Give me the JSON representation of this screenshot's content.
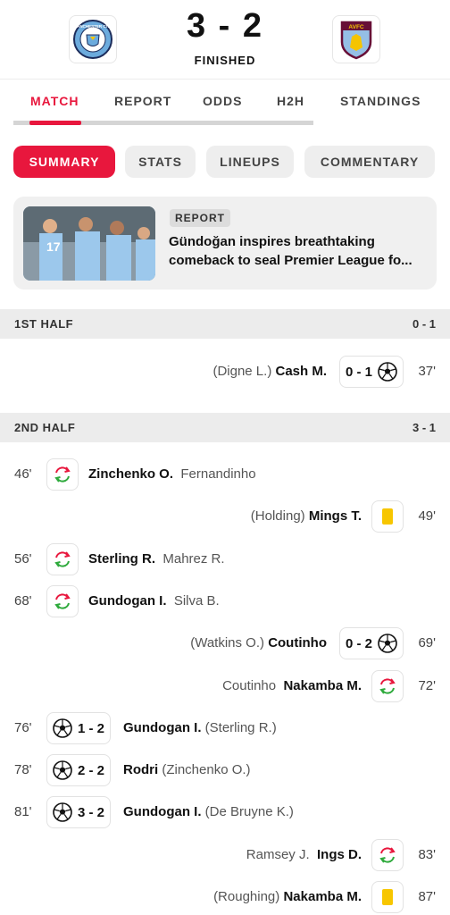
{
  "header": {
    "home_team_logo": "manchester-city-crest",
    "away_team_logo": "aston-villa-crest",
    "home_logo_text": "MANCHESTER CITY",
    "away_logo_text": "AVFC",
    "score": "3 - 2",
    "status": "FINISHED"
  },
  "main_tabs": [
    "MATCH",
    "REPORT",
    "ODDS",
    "H2H",
    "STANDINGS"
  ],
  "sub_tabs": [
    "SUMMARY",
    "STATS",
    "LINEUPS",
    "COMMENTARY"
  ],
  "report_card": {
    "badge": "REPORT",
    "title": "Gündoğan inspires breathtaking comeback to seal Premier League fo..."
  },
  "first_half": {
    "label": "1ST HALF",
    "score": "0 - 1",
    "events": [
      {
        "minute": "37'",
        "side": "away",
        "type": "goal",
        "score": "0 - 1",
        "player": "Cash M.",
        "detail": "(Digne L.)"
      }
    ]
  },
  "second_half": {
    "label": "2ND HALF",
    "score": "3 - 1",
    "events": [
      {
        "minute": "46'",
        "side": "home",
        "type": "substitution",
        "player": "Zinchenko O.",
        "detail": "Fernandinho"
      },
      {
        "minute": "49'",
        "side": "away",
        "type": "yellow-card",
        "player": "Mings T.",
        "detail": "(Holding)"
      },
      {
        "minute": "56'",
        "side": "home",
        "type": "substitution",
        "player": "Sterling R.",
        "detail": "Mahrez R."
      },
      {
        "minute": "68'",
        "side": "home",
        "type": "substitution",
        "player": "Gundogan I.",
        "detail": "Silva B."
      },
      {
        "minute": "69'",
        "side": "away",
        "type": "goal",
        "score": "0 - 2",
        "player": "Coutinho",
        "detail": "(Watkins O.)"
      },
      {
        "minute": "72'",
        "side": "away",
        "type": "substitution",
        "player": "Nakamba M.",
        "detail": "Coutinho"
      },
      {
        "minute": "76'",
        "side": "home",
        "type": "goal",
        "score": "1 - 2",
        "player": "Gundogan I.",
        "detail": "(Sterling R.)"
      },
      {
        "minute": "78'",
        "side": "home",
        "type": "goal",
        "score": "2 - 2",
        "player": "Rodri",
        "detail": "(Zinchenko O.)"
      },
      {
        "minute": "81'",
        "side": "home",
        "type": "goal",
        "score": "3 - 2",
        "player": "Gundogan I.",
        "detail": "(De Bruyne K.)"
      },
      {
        "minute": "83'",
        "side": "away",
        "type": "substitution",
        "player": "Ings D.",
        "detail": "Ramsey J."
      },
      {
        "minute": "87'",
        "side": "away",
        "type": "yellow-card",
        "player": "Nakamba M.",
        "detail": "(Roughing)"
      }
    ]
  },
  "colors": {
    "accent": "#e8173d",
    "yellow_card": "#f7c600",
    "sub_in": "#2eaa3c",
    "sub_out": "#e8173d"
  }
}
